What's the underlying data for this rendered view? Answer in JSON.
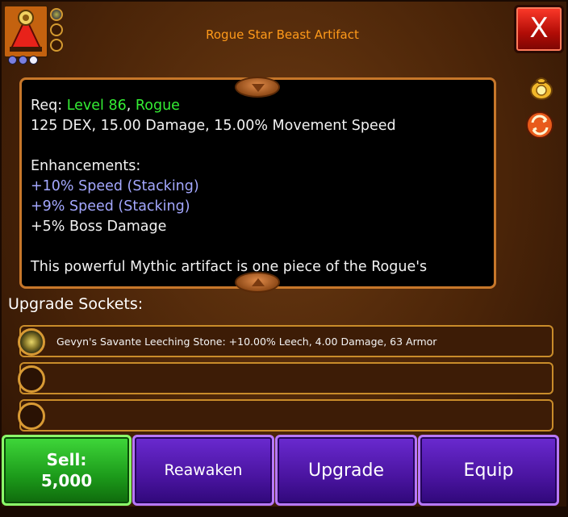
{
  "item": {
    "title": "Rogue Star Beast Artifact",
    "mini_sockets": [
      true,
      false,
      false
    ],
    "rarity_dots": [
      "purple",
      "purple",
      "white"
    ]
  },
  "close_button": {
    "label": "X"
  },
  "description": {
    "req_label": "Req: ",
    "level": "Level 86",
    "comma": ", ",
    "class": "Rogue",
    "stats": "125 DEX, 15.00 Damage, 15.00% Movement Speed",
    "enhancements_heading": "Enhancements:",
    "enhancements": [
      {
        "text": "+10% Speed (Stacking)",
        "color": "#a4a8ff"
      },
      {
        "text": "+9% Speed (Stacking)",
        "color": "#a4a8ff"
      },
      {
        "text": "+5% Boss Damage",
        "color": "#f2f2f2"
      }
    ],
    "flavor": "This powerful Mythic artifact is one piece of the Rogue's"
  },
  "side_icons": [
    "money-bag-icon",
    "swap-icon"
  ],
  "sockets": {
    "heading": "Upgrade Sockets:",
    "rows": [
      {
        "filled": true,
        "label": "Gevyn's Savante Leeching Stone: +10.00% Leech, 4.00 Damage, 63 Armor"
      },
      {
        "filled": false,
        "label": ""
      },
      {
        "filled": false,
        "label": ""
      }
    ]
  },
  "buttons": {
    "sell_label": "Sell:",
    "sell_price": "5,000",
    "reawaken": "Reawaken",
    "upgrade": "Upgrade",
    "equip": "Equip"
  },
  "colors": {
    "requirement_green": "#34ee34",
    "enhancement_purple": "#a4a8ff",
    "title_orange": "#ff9a1a",
    "sell_green": "#1c9a1a",
    "action_purple": "#4a14a0",
    "close_red": "#b00c06"
  }
}
